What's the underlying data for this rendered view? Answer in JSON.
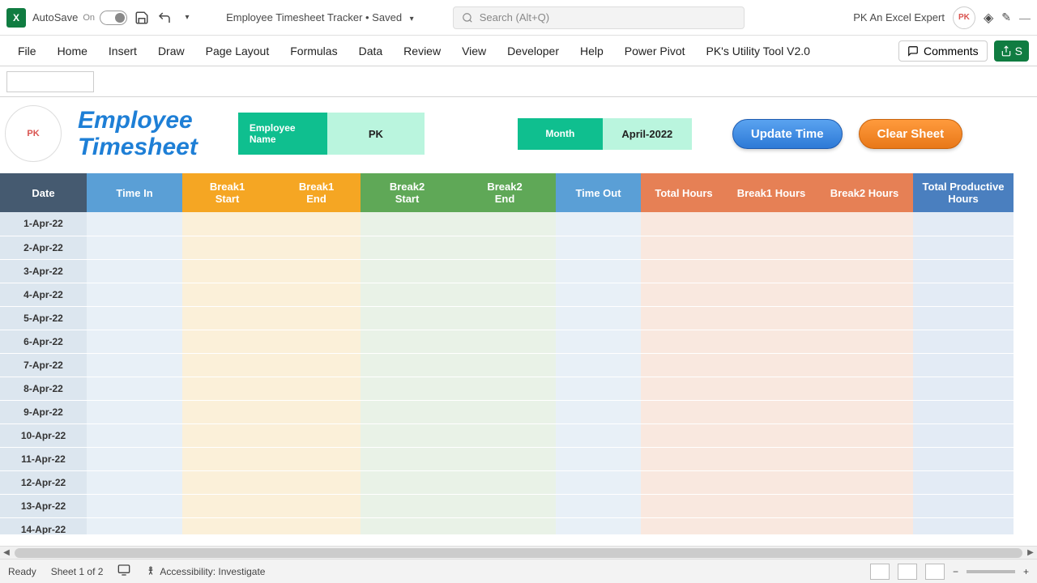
{
  "titlebar": {
    "autosave_label": "AutoSave",
    "autosave_state": "On",
    "doc_title": "Employee Timesheet Tracker • Saved",
    "search_placeholder": "Search (Alt+Q)",
    "user_name": "PK An Excel Expert"
  },
  "ribbon": {
    "tabs": [
      "File",
      "Home",
      "Insert",
      "Draw",
      "Page Layout",
      "Formulas",
      "Data",
      "Review",
      "View",
      "Developer",
      "Help",
      "Power Pivot",
      "PK's Utility Tool V2.0"
    ],
    "comments": "Comments",
    "share": "S"
  },
  "sheet": {
    "title_line1": "Employee",
    "title_line2": "Timesheet",
    "emp_label": "Employee Name",
    "emp_value": "PK",
    "month_label": "Month",
    "month_value": "April-2022",
    "btn_update": "Update Time",
    "btn_clear": "Clear Sheet"
  },
  "columns": {
    "date": "Date",
    "timein": "Time In",
    "b1s": "Break1\nStart",
    "b1e": "Break1\nEnd",
    "b2s": "Break2\nStart",
    "b2e": "Break2\nEnd",
    "timeout": "Time Out",
    "total": "Total Hours",
    "bh1": "Break1 Hours",
    "bh2": "Break2 Hours",
    "prod": "Total Productive\nHours"
  },
  "rows": [
    "1-Apr-22",
    "2-Apr-22",
    "3-Apr-22",
    "4-Apr-22",
    "5-Apr-22",
    "6-Apr-22",
    "7-Apr-22",
    "8-Apr-22",
    "9-Apr-22",
    "10-Apr-22",
    "11-Apr-22",
    "12-Apr-22",
    "13-Apr-22",
    "14-Apr-22"
  ],
  "statusbar": {
    "ready": "Ready",
    "sheet": "Sheet 1 of 2",
    "accessibility": "Accessibility: Investigate"
  }
}
